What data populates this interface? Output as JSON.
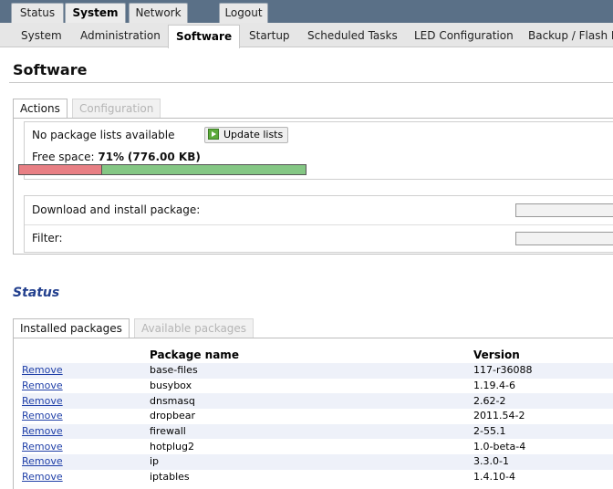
{
  "top_tabs": [
    "Status",
    "System",
    "Network",
    "Logout"
  ],
  "sub_tabs": [
    "System",
    "Administration",
    "Software",
    "Startup",
    "Scheduled Tasks",
    "LED Configuration",
    "Backup / Flash F"
  ],
  "page": {
    "title": "Software"
  },
  "actions": {
    "tabs": [
      "Actions",
      "Configuration"
    ],
    "no_lists_text": "No package lists available",
    "update_button": "Update lists",
    "free_space_label": "Free space:",
    "free_space_percent": "71%",
    "free_space_amount": "(776.00 KB)",
    "free_fraction": 0.71,
    "download_label": "Download and install package:",
    "filter_label": "Filter:"
  },
  "status": {
    "title": "Status",
    "tabs": [
      "Installed packages",
      "Available packages"
    ],
    "columns": [
      "",
      "Package name",
      "Version"
    ],
    "remove_label": "Remove",
    "packages": [
      {
        "name": "base-files",
        "version": "117-r36088"
      },
      {
        "name": "busybox",
        "version": "1.19.4-6"
      },
      {
        "name": "dnsmasq",
        "version": "2.62-2"
      },
      {
        "name": "dropbear",
        "version": "2011.54-2"
      },
      {
        "name": "firewall",
        "version": "2-55.1"
      },
      {
        "name": "hotplug2",
        "version": "1.0-beta-4"
      },
      {
        "name": "ip",
        "version": "3.3.0-1"
      },
      {
        "name": "iptables",
        "version": "1.4.10-4"
      }
    ]
  }
}
